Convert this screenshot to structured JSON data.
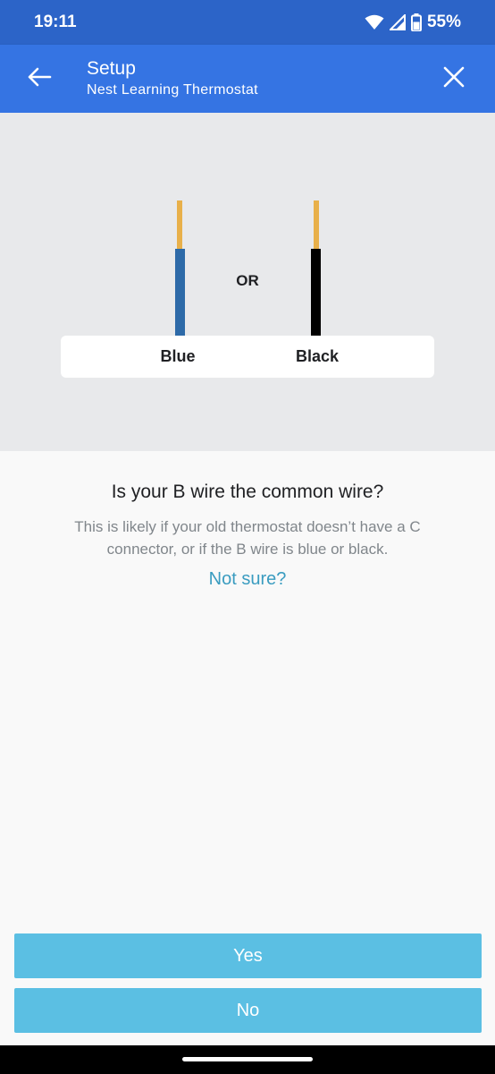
{
  "status_bar": {
    "time": "19:11",
    "battery": "55%",
    "icons": [
      "wifi-icon",
      "cellular-signal-icon",
      "battery-icon"
    ]
  },
  "app_bar": {
    "title": "Setup",
    "subtitle": "Nest Learning Thermostat",
    "back_icon": "arrow-back-icon",
    "close_icon": "close-icon"
  },
  "illustration": {
    "separator": "OR",
    "wires": [
      {
        "label": "Blue",
        "color": "#2d6aa8"
      },
      {
        "label": "Black",
        "color": "#000000"
      }
    ],
    "cap_color": "#e8b04a"
  },
  "content": {
    "question": "Is your B wire the common wire?",
    "description": "This is likely if your old thermostat doesn’t have a C connector, or if the B wire is blue or black.",
    "help_link": "Not sure?"
  },
  "actions": {
    "yes_label": "Yes",
    "no_label": "No"
  },
  "colors": {
    "status_bar": "#2c64c8",
    "app_bar": "#3574e3",
    "button": "#5bbfe3",
    "link": "#3a9cc0"
  }
}
